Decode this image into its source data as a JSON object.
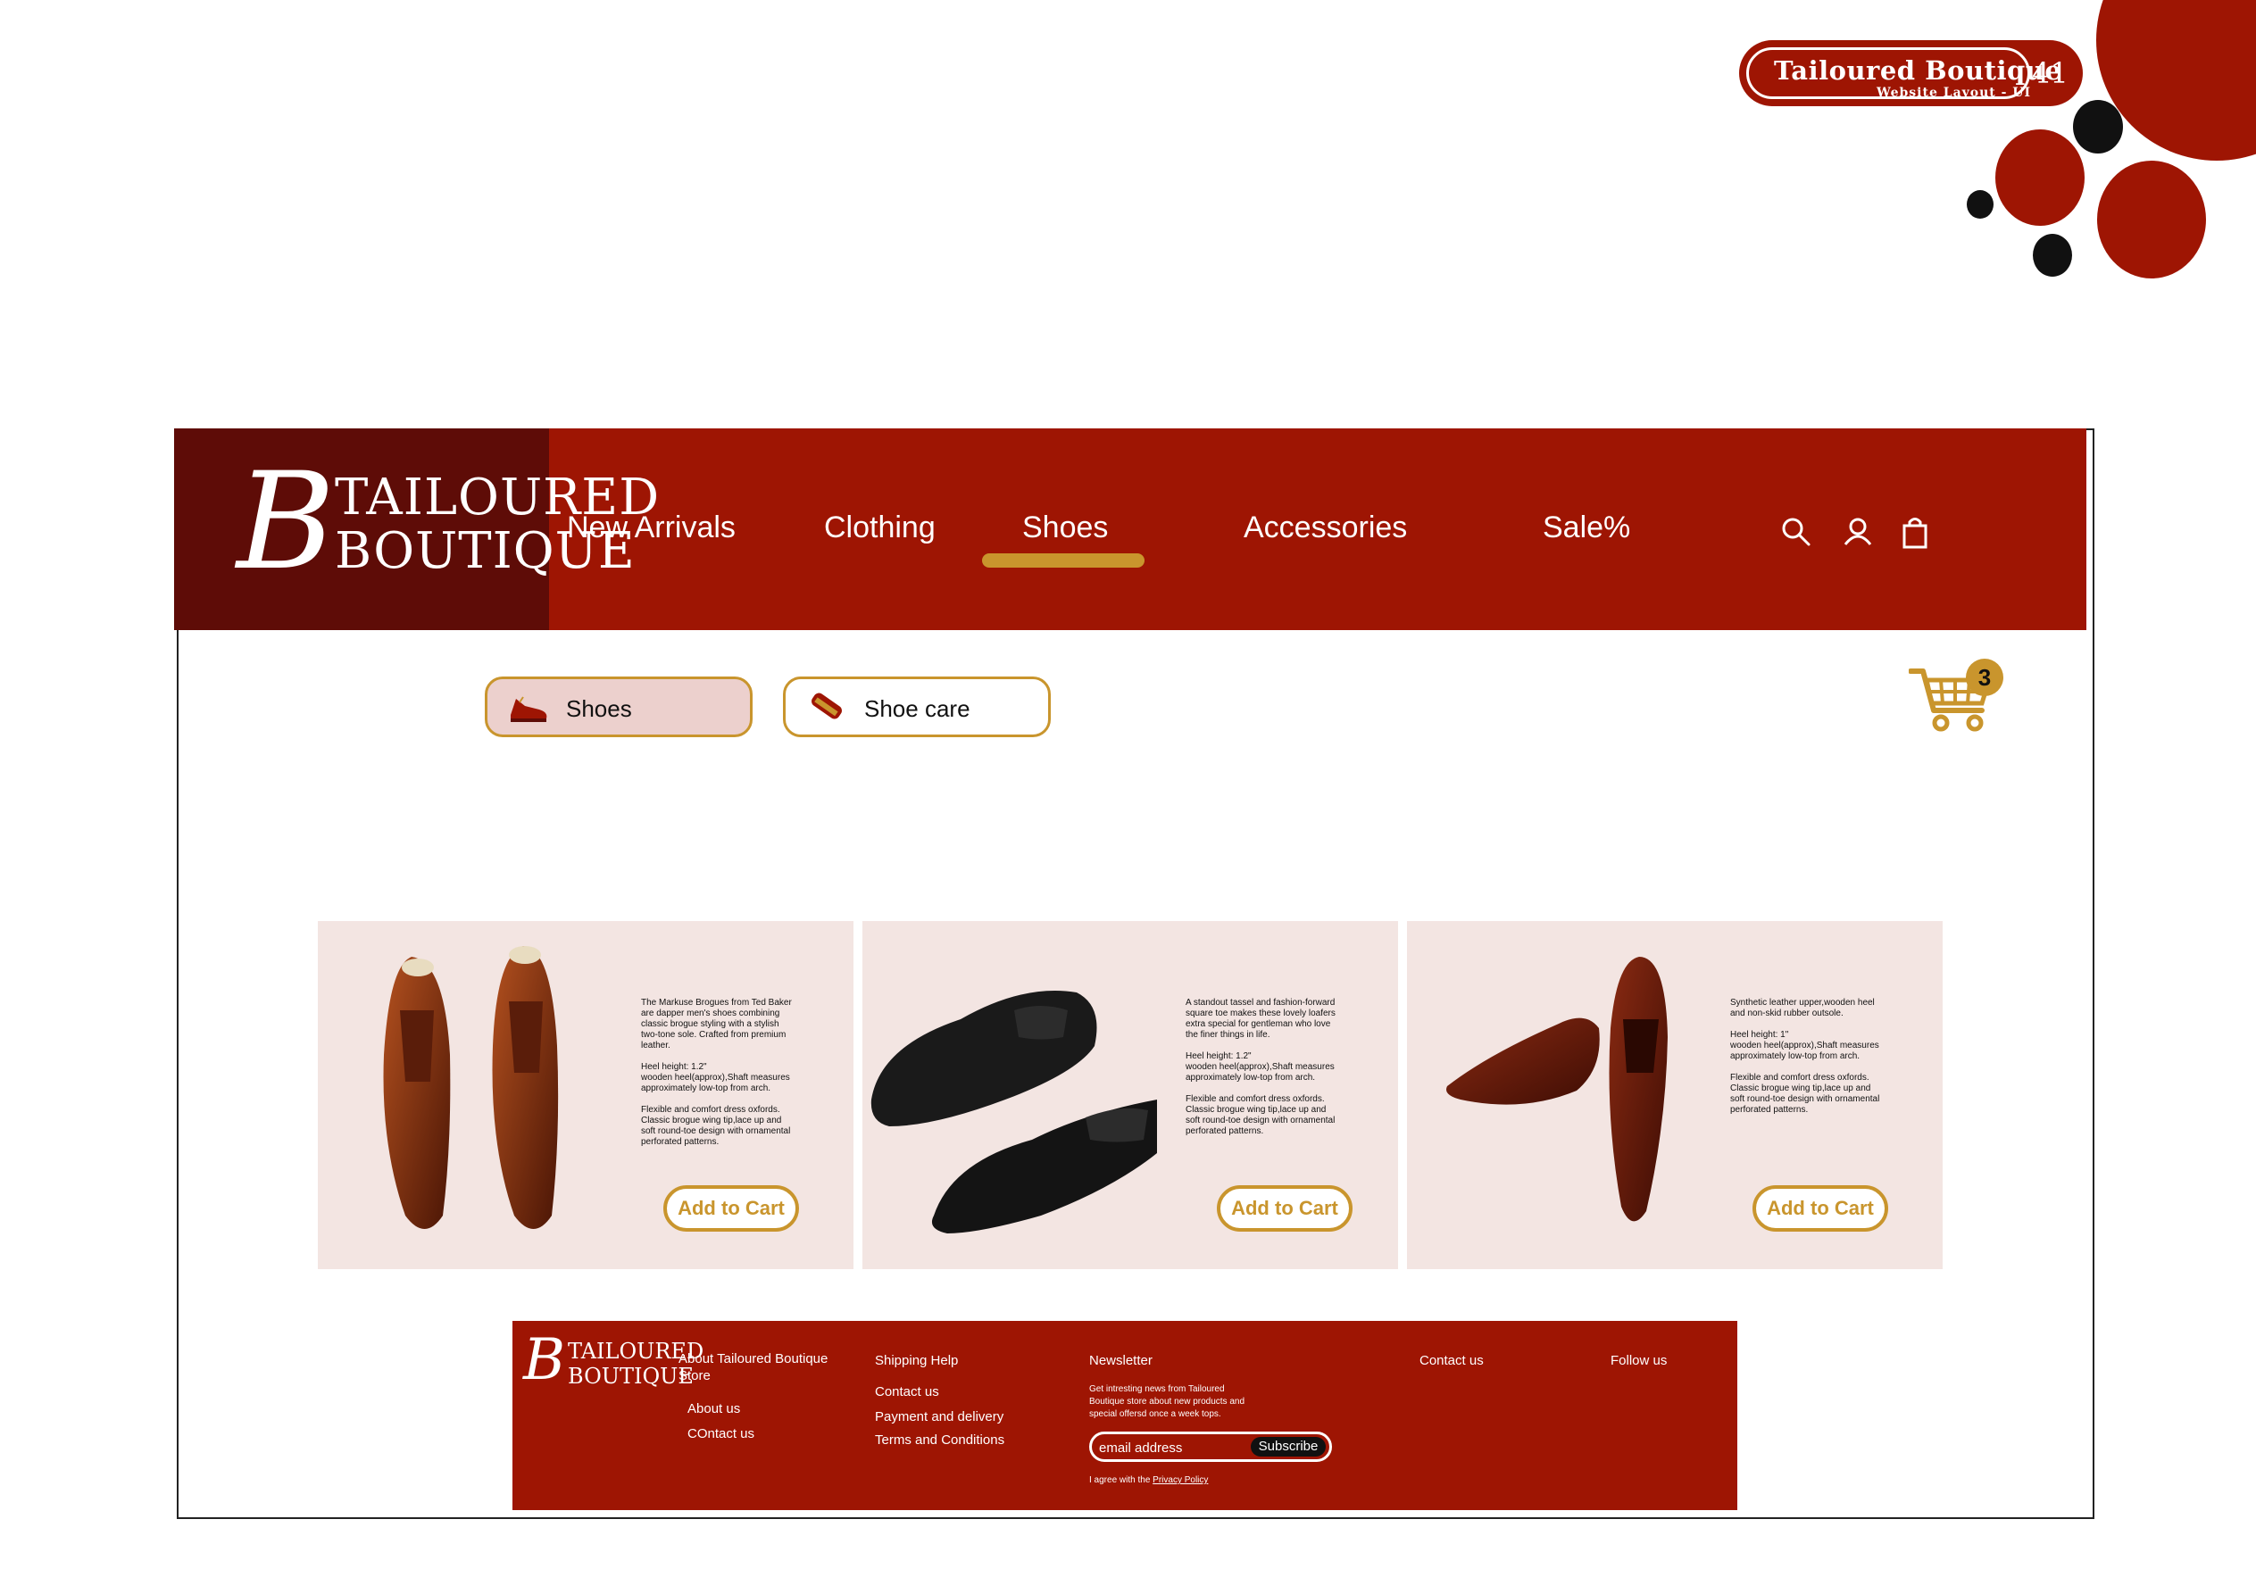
{
  "doc_badge": {
    "title": "Tailoured Boutique",
    "subtitle": "Website Layout - UI",
    "page_number": "41"
  },
  "brand": {
    "logo_letter": "B",
    "logo_line1": "TAILOURED",
    "logo_line2": "BOUTIQUE"
  },
  "nav": {
    "items": [
      {
        "label": "New Arrivals"
      },
      {
        "label": "Clothing"
      },
      {
        "label": "Shoes",
        "active": true
      },
      {
        "label": "Accessories"
      },
      {
        "label": "Sale%"
      }
    ],
    "icons": [
      "search-icon",
      "user-icon",
      "shopping-bag-icon"
    ]
  },
  "categories": [
    {
      "label": "Shoes",
      "icon": "shoe-icon",
      "selected": true
    },
    {
      "label": "Shoe care",
      "icon": "shoe-brush-icon",
      "selected": false
    }
  ],
  "cart": {
    "count": "3",
    "icon": "shopping-cart-icon"
  },
  "products": [
    {
      "description": "The Markuse Brogues from Ted Baker\nare dapper men's shoes combining\nclassic brogue styling with a stylish\ntwo-tone sole. Crafted from premium\nleather.\n\nHeel height: 1.2\"\nwooden heel(approx),Shaft measures\napproximately low-top from arch.\n\nFlexible and comfort dress oxfords.\nClassic brogue wing tip,lace up and\nsoft round-toe design with ornamental\nperforated patterns.",
      "button": "Add to Cart"
    },
    {
      "description": "A standout tassel and fashion-forward\nsquare toe makes these lovely loafers\nextra special for gentleman who love\nthe finer things in life.\n\nHeel height: 1.2\"\nwooden heel(approx),Shaft measures\napproximately low-top from arch.\n\nFlexible and comfort dress oxfords.\nClassic brogue wing tip,lace up and\nsoft round-toe design with ornamental\nperforated patterns.",
      "button": "Add to Cart"
    },
    {
      "description": "Synthetic leather upper,wooden heel\nand non-skid rubber outsole.\n\nHeel height: 1\"\nwooden heel(approx),Shaft measures\napproximately low-top from arch.\n\nFlexible and comfort dress oxfords.\nClassic brogue wing tip,lace up and\nsoft round-toe design with ornamental\nperforated patterns.",
      "button": "Add to Cart"
    }
  ],
  "footer": {
    "logo_letter": "B",
    "logo_line1": "TAILOURED",
    "logo_line2": "BOUTIQUE",
    "about_heading_1": "About Tailoured Boutique",
    "about_heading_2": "Store",
    "about_links": [
      "About us",
      "COntact us"
    ],
    "shipping_heading": "Shipping Help",
    "shipping_links": [
      "Contact us",
      "Payment and delivery",
      "Terms and Conditions"
    ],
    "newsletter_heading": "Newsletter",
    "newsletter_text": "Get intresting news  from Tailoured\nBoutique store about new products and\nspecial offersd once a week tops.",
    "email_placeholder": "email address",
    "subscribe_label": "Subscribe",
    "agree_text": "I agree with the",
    "privacy_link": "Privacy Policy",
    "contact_heading": "Contact us",
    "follow_heading": "Follow us"
  },
  "colors": {
    "brand_red": "#9e1503",
    "logo_dark": "#5e0c07",
    "gold": "#c9952d",
    "card_bg": "#f3e5e2",
    "pill_selected": "#ecd0cd"
  }
}
